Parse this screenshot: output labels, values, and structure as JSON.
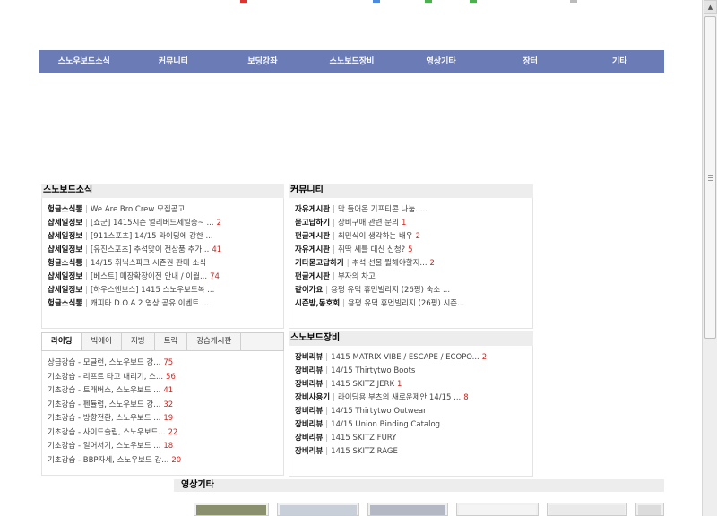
{
  "colors": {
    "nav_bg": "#6b7bb6",
    "count_red": "#d0221c",
    "panel_title_bg": "#ededed"
  },
  "nav": {
    "items": [
      "스노우보드소식",
      "커뮤니티",
      "보딩강좌",
      "스노보드장비",
      "영상기타",
      "장터",
      "기타"
    ]
  },
  "snowboard_news": {
    "title": "스노보드소식",
    "items": [
      {
        "category": "헝글소식통",
        "text": "We Are Bro Crew 모집공고",
        "count": ""
      },
      {
        "category": "샵세일정보",
        "text": "[쇼군] 1415시즌 얼리버드세일중~ ...",
        "count": "2"
      },
      {
        "category": "샵세일정보",
        "text": "[911스포츠] 14/15 라이딩에 강한 ...",
        "count": ""
      },
      {
        "category": "샵세일정보",
        "text": "[유진스포츠] 추석맞이 전상품 추가...",
        "count": "41"
      },
      {
        "category": "헝글소식통",
        "text": "14/15 휘닉스파크 시즌권 판매 소식",
        "count": ""
      },
      {
        "category": "샵세일정보",
        "text": "[베스트] 매장확장이전 안내 / 이월...",
        "count": "74"
      },
      {
        "category": "샵세일정보",
        "text": "[하우스앤보스] 1415 스노우보드복 ...",
        "count": ""
      },
      {
        "category": "헝글소식통",
        "text": "캐피타 D.O.A 2 영상 공유 이벤트 ...",
        "count": ""
      }
    ]
  },
  "community": {
    "title": "커뮤니티",
    "items": [
      {
        "category": "자유게시판",
        "text": "막 들어온 기프티콘 나눔.....",
        "count": ""
      },
      {
        "category": "묻고답하기",
        "text": "장비구매 관련 문의",
        "count": "1"
      },
      {
        "category": "펀글게시판",
        "text": "최민식이 생각하는 배우",
        "count": "2"
      },
      {
        "category": "자유게시판",
        "text": "취딱 세틀 대신 신청?",
        "count": "5"
      },
      {
        "category": "기타묻고답하기",
        "text": "추석 선물 뭘해야할지...",
        "count": "2"
      },
      {
        "category": "펀글게시판",
        "text": "부자의 차고",
        "count": ""
      },
      {
        "category": "같이가요",
        "text": "용평 유덕 휴먼빌리지 (26평) 숙소 ...",
        "count": ""
      },
      {
        "category": "시즌방,동호회",
        "text": "용평 유덕 휴먼빌리지 (26평) 시즌...",
        "count": ""
      }
    ]
  },
  "lessons": {
    "tabs": [
      "라이딩",
      "빅에어",
      "지빙",
      "트릭",
      "강습게시판"
    ],
    "active_tab": 0,
    "items": [
      {
        "text": "상급강습 - 모글런, 스노우보드 강...",
        "count": "75"
      },
      {
        "text": "기초강습 - 리프트 타고 내리기, 스...",
        "count": "56"
      },
      {
        "text": "기초강습 - 트래버스, 스노우보드 ...",
        "count": "41"
      },
      {
        "text": "기초강습 - 펜듈럼, 스노우보드 강...",
        "count": "32"
      },
      {
        "text": "기초강습 - 방향전환, 스노우보드 ...",
        "count": "19"
      },
      {
        "text": "기초강습 - 사이드슬립, 스노우보드...",
        "count": "22"
      },
      {
        "text": "기초강습 - 일어서기, 스노우보드 ...",
        "count": "18"
      },
      {
        "text": "기초강습 - BBP자세, 스노우보드 강...",
        "count": "20"
      }
    ]
  },
  "equipment": {
    "title": "스노보드장비",
    "items": [
      {
        "category": "장비리뷰",
        "text": "1415 MATRIX VIBE / ESCAPE / ECOPO...",
        "count": "2"
      },
      {
        "category": "장비리뷰",
        "text": "14/15 Thirtytwo Boots",
        "count": ""
      },
      {
        "category": "장비리뷰",
        "text": "1415 SKITZ JERK",
        "count": "1"
      },
      {
        "category": "장비사용기",
        "text": "라이딩용 부츠의 새로운제안 14/15 ...",
        "count": "8"
      },
      {
        "category": "장비리뷰",
        "text": "14/15 Thirtytwo Outwear",
        "count": ""
      },
      {
        "category": "장비리뷰",
        "text": "14/15 Union Binding Catalog",
        "count": ""
      },
      {
        "category": "장비리뷰",
        "text": "1415 SKITZ FURY",
        "count": ""
      },
      {
        "category": "장비리뷰",
        "text": "1415 SKITZ RAGE",
        "count": ""
      }
    ]
  },
  "video": {
    "title": "영상기타"
  }
}
